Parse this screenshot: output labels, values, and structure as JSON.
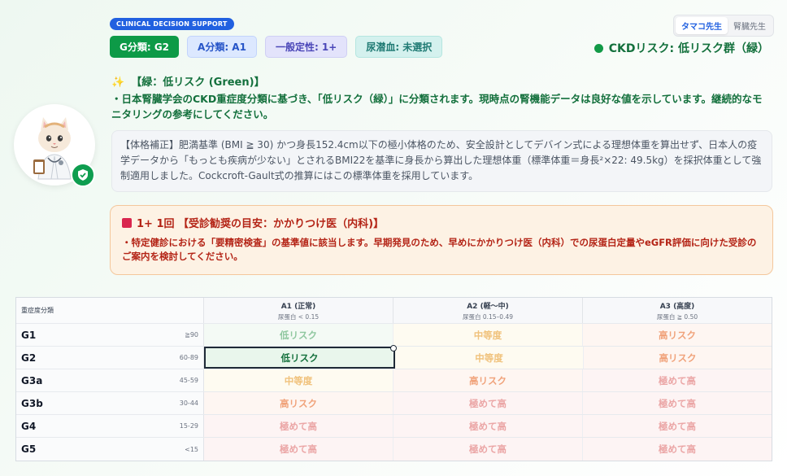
{
  "app": {
    "badge": "CLINICAL DECISION SUPPORT",
    "tags": {
      "g": "G分類: G2",
      "a": "A分類: A1",
      "proteinuria": "一般定性: 1+",
      "occult": "尿潜血: 未選択"
    },
    "mode_tabs": [
      "タマコ先生",
      "腎臓先生"
    ],
    "active_mode": "タマコ先生",
    "risk_summary": "CKDリスク: 低リスク群（緑）",
    "risk_color": "#129a47"
  },
  "result": {
    "title_icon": "✨",
    "title": "【緑：低リスク (Green)】",
    "description": "・日本腎臓学会のCKD重症度分類に基づき、「低リスク（緑）」に分類されます。現時点の腎機能データは良好な値を示しています。継続的なモニタリングの参考にしてください。",
    "note": "【体格補正】肥満基準 (BMI ≧ 30) かつ身長152.4cm以下の極小体格のため、安全設計としてデバイン式による理想体重を算出せず、日本人の疫学データから「もっとも疾病が少ない」とされるBMI22を基準に身長から算出した理想体重（標準体重＝身長²×22: 49.5kg）を採択体重として強制適用しました。Cockcroft-Gault式の推算にはこの標準体重を採用しています。"
  },
  "alert": {
    "title": "1+ 1回 【受診勧奨の目安：かかりつけ医（内科)】",
    "text": "・特定健診における「要精密検査」の基準値に該当します。早期発見のため、早めにかかりつけ医（内科）での尿蛋白定量やeGFR評価に向けた受診のご案内を検討してください。"
  },
  "matrix": {
    "corner_label": "重症度分類",
    "columns": [
      {
        "title": "A1 (正常)",
        "sub": "尿蛋白 < 0.15"
      },
      {
        "title": "A2 (軽〜中)",
        "sub": "尿蛋白 0.15–0.49"
      },
      {
        "title": "A3 (高度)",
        "sub": "尿蛋白 ≧ 0.50"
      }
    ],
    "rows": [
      {
        "g": "G1",
        "range": "≧90",
        "cells": [
          "低リスク",
          "中等度",
          "高リスク"
        ]
      },
      {
        "g": "G2",
        "range": "60-89",
        "cells": [
          "低リスク",
          "中等度",
          "高リスク"
        ]
      },
      {
        "g": "G3a",
        "range": "45-59",
        "cells": [
          "中等度",
          "高リスク",
          "極めて高"
        ]
      },
      {
        "g": "G3b",
        "range": "30-44",
        "cells": [
          "高リスク",
          "極めて高",
          "極めて高"
        ]
      },
      {
        "g": "G4",
        "range": "15-29",
        "cells": [
          "極めて高",
          "極めて高",
          "極めて高"
        ]
      },
      {
        "g": "G5",
        "range": "<15",
        "cells": [
          "極めて高",
          "極めて高",
          "極めて高"
        ]
      }
    ],
    "selected": {
      "row": "G2",
      "column": "A1 (正常)"
    }
  }
}
